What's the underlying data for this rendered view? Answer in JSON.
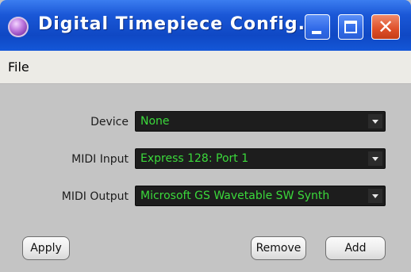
{
  "window": {
    "title": "Digital Timepiece Config...",
    "app_icon": "app-orb-icon",
    "controls": {
      "minimize_icon": "minimize-icon",
      "maximize_icon": "maximize-icon",
      "close_glyph": "✕"
    }
  },
  "menu": {
    "items": [
      {
        "label": "File"
      }
    ]
  },
  "form": {
    "device": {
      "label": "Device",
      "value": "None"
    },
    "midi_input": {
      "label": "MIDI Input",
      "value": "Express  128: Port 1"
    },
    "midi_output": {
      "label": "MIDI Output",
      "value": "Microsoft GS Wavetable SW Synth"
    }
  },
  "buttons": {
    "apply": "Apply",
    "remove": "Remove",
    "add": "Add"
  },
  "colors": {
    "titlebar": "#1a57d6",
    "combo_bg": "#1d1d1d",
    "combo_text": "#3bd93b",
    "body_bg": "#c4c4c4"
  }
}
